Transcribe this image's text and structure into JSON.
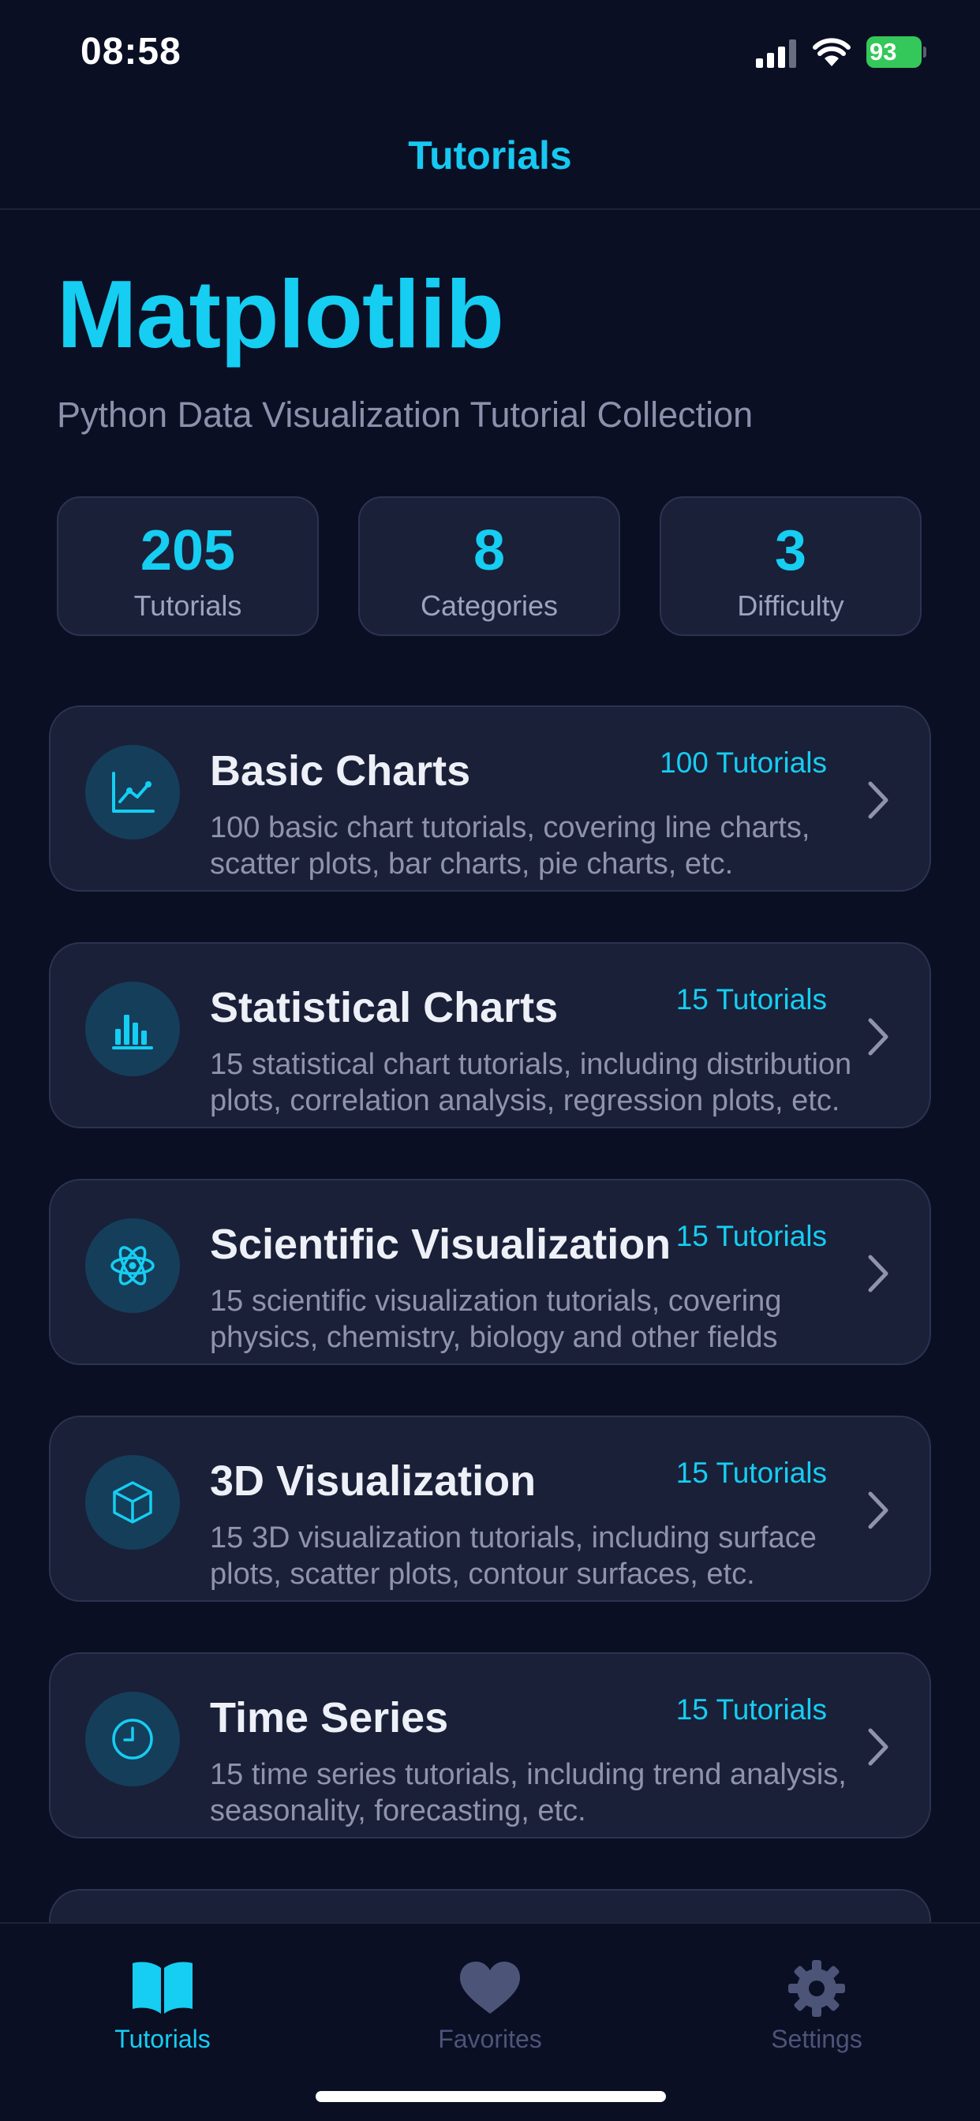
{
  "status_bar": {
    "time": "08:58",
    "battery": "93"
  },
  "nav": {
    "title": "Tutorials"
  },
  "hero": {
    "title": "Matplotlib",
    "subtitle": "Python Data Visualization Tutorial Collection"
  },
  "stats": [
    {
      "value": "205",
      "label": "Tutorials"
    },
    {
      "value": "8",
      "label": "Categories"
    },
    {
      "value": "3",
      "label": "Difficulty"
    }
  ],
  "categories": [
    {
      "title": "Basic Charts",
      "count": "100 Tutorials",
      "icon": "line-chart-icon",
      "description": "100 basic chart tutorials, covering line charts, scatter plots, bar charts, pie charts, etc."
    },
    {
      "title": "Statistical Charts",
      "count": "15 Tutorials",
      "icon": "bar-chart-icon",
      "description": "15 statistical chart tutorials, including distribution plots, correlation analysis, regression plots, etc."
    },
    {
      "title": "Scientific Visualization",
      "count": "15 Tutorials",
      "icon": "atom-icon",
      "description": "15 scientific visualization tutorials, covering physics, chemistry, biology and other fields"
    },
    {
      "title": "3D Visualization",
      "count": "15 Tutorials",
      "icon": "cube-icon",
      "description": "15 3D visualization tutorials, including surface plots, scatter plots, contour surfaces, etc."
    },
    {
      "title": "Time Series",
      "count": "15 Tutorials",
      "icon": "clock-icon",
      "description": "15 time series tutorials, including trend analysis, seasonality, forecasting, etc."
    }
  ],
  "tab_bar": {
    "tabs": [
      {
        "label": "Tutorials",
        "icon": "book-icon",
        "active": true
      },
      {
        "label": "Favorites",
        "icon": "heart-icon",
        "active": false
      },
      {
        "label": "Settings",
        "icon": "gear-icon",
        "active": false
      }
    ]
  },
  "colors": {
    "accent": "#16cdf2",
    "background": "#0a0f24",
    "card": "#1a2038",
    "inactive": "#4c5478"
  }
}
